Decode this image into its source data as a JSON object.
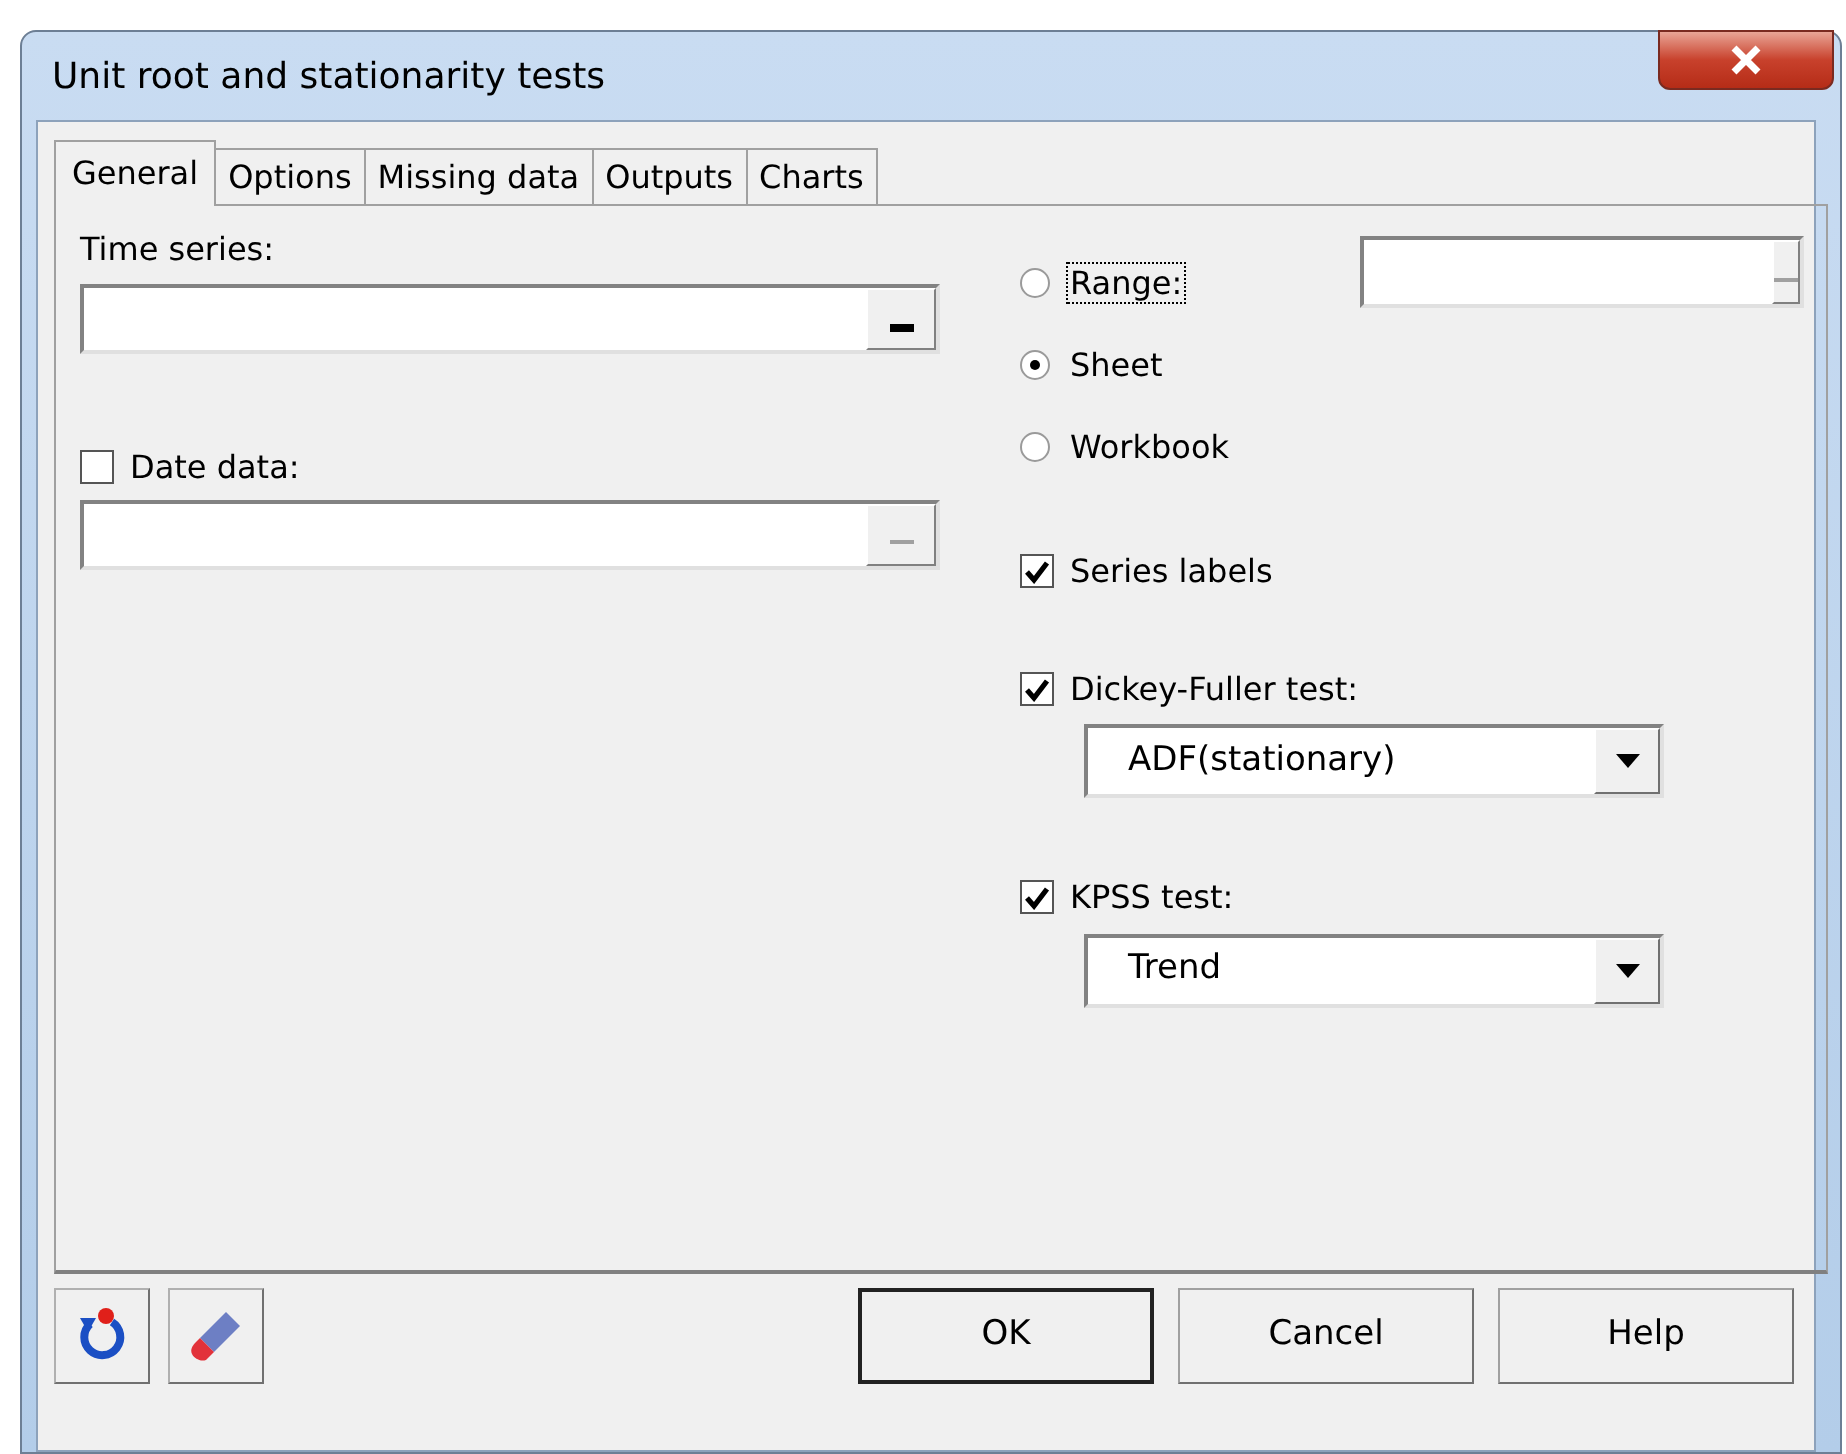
{
  "window": {
    "title": "Unit root and stationarity tests"
  },
  "tabs": [
    {
      "label": "General",
      "selected": true
    },
    {
      "label": "Options",
      "selected": false
    },
    {
      "label": "Missing data",
      "selected": false
    },
    {
      "label": "Outputs",
      "selected": false
    },
    {
      "label": "Charts",
      "selected": false
    }
  ],
  "time_series": {
    "label": "Time series:",
    "disabled": false
  },
  "date_data": {
    "label": "Date data:",
    "checked": false,
    "disabled": true
  },
  "location": {
    "options": [
      {
        "label": "Range:",
        "selected": false,
        "focused": true
      },
      {
        "label": "Sheet",
        "selected": true,
        "focused": false
      },
      {
        "label": "Workbook",
        "selected": false,
        "focused": false
      }
    ],
    "range_field": {
      "disabled": true
    }
  },
  "series_labels": {
    "label": "Series labels",
    "checked": true
  },
  "tests": [
    {
      "label": "Dickey-Fuller test:",
      "checked": true,
      "value": "ADF(stationary)"
    },
    {
      "label": "KPSS test:",
      "checked": true,
      "value": "Trend"
    }
  ],
  "buttons": [
    {
      "label": "OK",
      "default": true
    },
    {
      "label": "Cancel",
      "default": false
    },
    {
      "label": "Help",
      "default": false
    }
  ]
}
